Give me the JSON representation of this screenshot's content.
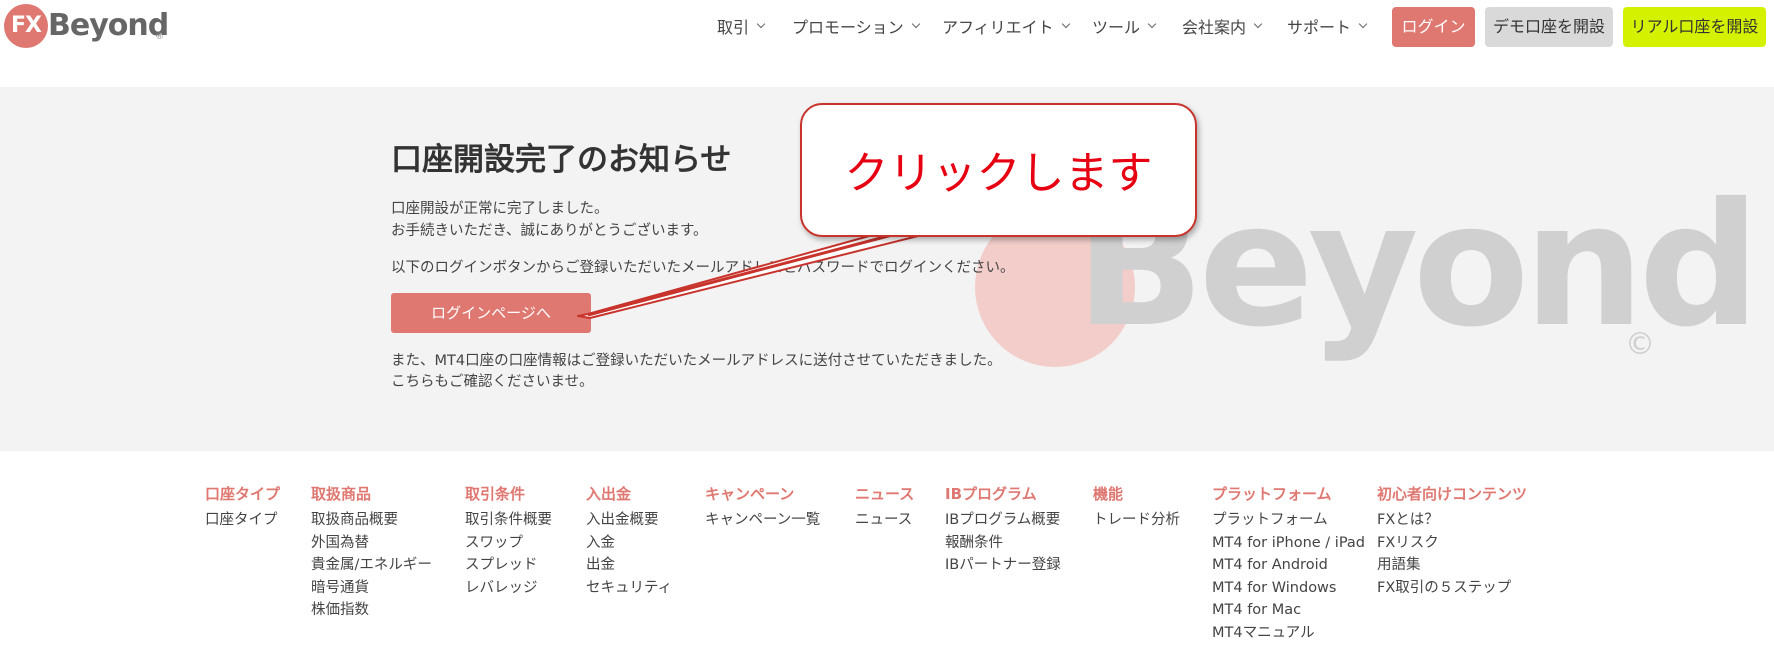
{
  "header": {
    "logo": {
      "mark": "FX",
      "word": "Beyond",
      "reg": "®"
    },
    "nav": [
      {
        "label": "取引"
      },
      {
        "label": "プロモーション"
      },
      {
        "label": "アフィリエイト"
      },
      {
        "label": "ツール"
      },
      {
        "label": "会社案内"
      },
      {
        "label": "サポート"
      }
    ],
    "login_label": "ログイン",
    "demo_label": "デモ口座を開設",
    "real_label": "リアル口座を開設"
  },
  "main": {
    "title": "口座開設完了のお知らせ",
    "line1": "口座開設が正常に完了しました。",
    "line2": "お手続きいただき、誠にありがとうございます。",
    "line3": "以下のログインボタンからご登録いただいたメールアドレスとパスワードでログインください。",
    "login_page_button": "ログインページへ",
    "line4": "また、MT4口座の口座情報はご登録いただいたメールアドレスに送付させていただきました。",
    "line5": "こちらもご確認くださいませ。",
    "watermark": {
      "text": "Beyond",
      "reg": "©"
    }
  },
  "callout": {
    "text": "クリックします"
  },
  "footer": {
    "columns": [
      {
        "heading": "口座タイプ",
        "links": [
          "口座タイプ"
        ]
      },
      {
        "heading": "取扱商品",
        "links": [
          "取扱商品概要",
          "外国為替",
          "貴金属/エネルギー",
          "暗号通貨",
          "株価指数"
        ]
      },
      {
        "heading": "取引条件",
        "links": [
          "取引条件概要",
          "スワップ",
          "スプレッド",
          "レバレッジ"
        ]
      },
      {
        "heading": "入出金",
        "links": [
          "入出金概要",
          "入金",
          "出金",
          "セキュリティ"
        ]
      },
      {
        "heading": "キャンペーン",
        "links": [
          "キャンペーン一覧"
        ]
      },
      {
        "heading": "ニュース",
        "links": [
          "ニュース"
        ]
      },
      {
        "heading": "IBプログラム",
        "links": [
          "IBプログラム概要",
          "報酬条件",
          "IBパートナー登録"
        ]
      },
      {
        "heading": "機能",
        "links": [
          "トレード分析"
        ]
      },
      {
        "heading": "プラットフォーム",
        "links": [
          "プラットフォーム",
          "MT4 for iPhone / iPad",
          "MT4 for Android",
          "MT4 for Windows",
          "MT4 for Mac",
          "MT4マニュアル"
        ]
      },
      {
        "heading": "初心者向けコンテンツ",
        "links": [
          "FXとは？",
          "FXリスク",
          "用語集",
          "FX取引の５ステップ"
        ]
      }
    ]
  },
  "colors": {
    "brand": "#e07872",
    "accent_lime": "#d4f200",
    "callout_red": "#e60012"
  }
}
